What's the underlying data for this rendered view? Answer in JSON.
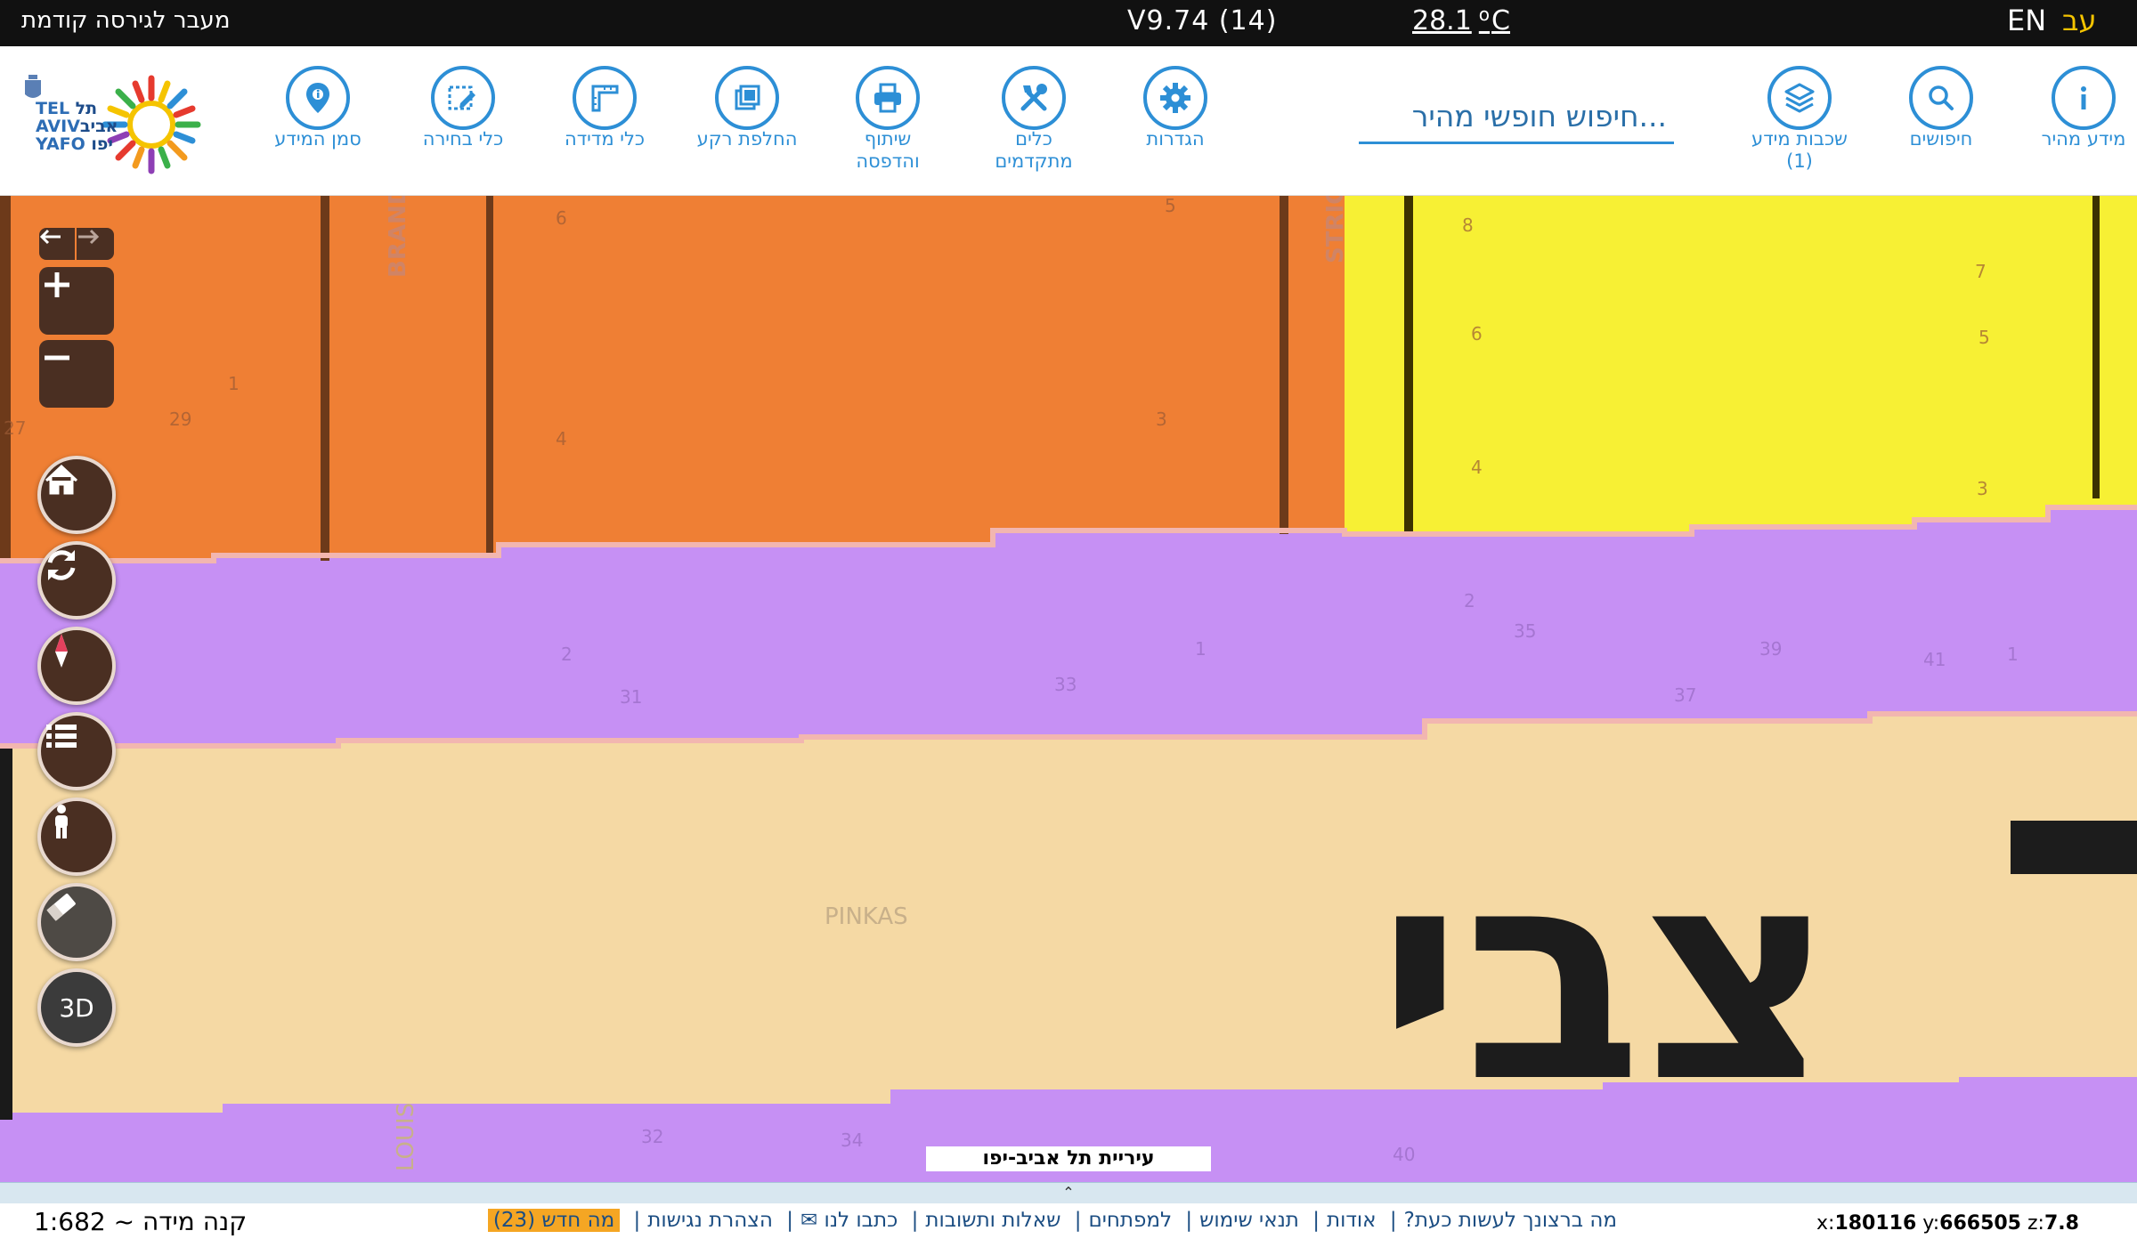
{
  "topbar": {
    "prev_version": "מעבר לגירסה קודמת",
    "version": "V9.74 (14)",
    "temperature": "28.1",
    "temp_unit": "C",
    "lang_en": "EN",
    "lang_he": "עב"
  },
  "logo": {
    "text_tel": "TEL",
    "text_aviv": "AVIV",
    "text_yafo": "YAFO",
    "text_he1": "תל",
    "text_he2": "אביב",
    "text_he3": "יפו"
  },
  "toolbar": {
    "tools": [
      {
        "name": "tool-mark-info",
        "icon": "location-pin-icon",
        "label": "סמן המידע",
        "label2": ""
      },
      {
        "name": "tool-selection",
        "icon": "pencil-select-icon",
        "label": "כלי בחירה",
        "label2": ""
      },
      {
        "name": "tool-measure",
        "icon": "ruler-icon",
        "label": "כלי מדידה",
        "label2": ""
      },
      {
        "name": "tool-basemap",
        "icon": "layers-swap-icon",
        "label": "החלפת רקע",
        "label2": ""
      },
      {
        "name": "tool-share-print",
        "icon": "printer-icon",
        "label": "שיתוף",
        "label2": "והדפסה"
      },
      {
        "name": "tool-advanced",
        "icon": "tools-icon",
        "label": "כלים",
        "label2": "מתקדמים"
      },
      {
        "name": "tool-settings",
        "icon": "gear-icon",
        "label": "הגדרות",
        "label2": ""
      },
      {
        "name": "tool-layers",
        "icon": "layers-icon",
        "label": "שכבות מידע",
        "label2": "(1)"
      },
      {
        "name": "tool-searches",
        "icon": "search-icon",
        "label": "חיפושים",
        "label2": ""
      },
      {
        "name": "tool-quick-info",
        "icon": "info-icon",
        "label": "מידע מהיר",
        "label2": ""
      }
    ],
    "search_placeholder": "חיפוש חופשי מהיר..."
  },
  "map": {
    "street_labels": [
      "BRAND",
      "STRIC",
      "PINKAS",
      "LOUIS"
    ],
    "big_label": "צבי",
    "parcel_numbers": [
      "6",
      "5",
      "8",
      "7",
      "1",
      "29",
      "27",
      "4",
      "3",
      "6",
      "5",
      "4",
      "3",
      "2",
      "35",
      "39",
      "41",
      "1",
      "2",
      "31",
      "33",
      "1",
      "37",
      "32",
      "34",
      "40"
    ],
    "credit": "עיריית תל אביב-יפו"
  },
  "controls": {
    "three_d": "3D"
  },
  "footer": {
    "scale_label": "קנה מידה ~ 1:682",
    "links": [
      "מה ברצונך לעשות כעת?",
      "אודות",
      "תנאי שימוש",
      "למפתחים",
      "שאלות ותשובות",
      "כתבו לנו ✉",
      "הצהרת נגישות"
    ],
    "whats_new": "מה חדש (23)",
    "coord_x_label": "x:",
    "coord_x": "180116",
    "coord_y_label": "y:",
    "coord_y": "666505",
    "coord_z_label": "z:",
    "coord_z": "7.8"
  },
  "colors": {
    "accent": "#2d8fd6",
    "orange": "#ef7f34",
    "yellow": "#f7f034",
    "purple": "#c690f4",
    "beige": "#f5d9a4"
  }
}
